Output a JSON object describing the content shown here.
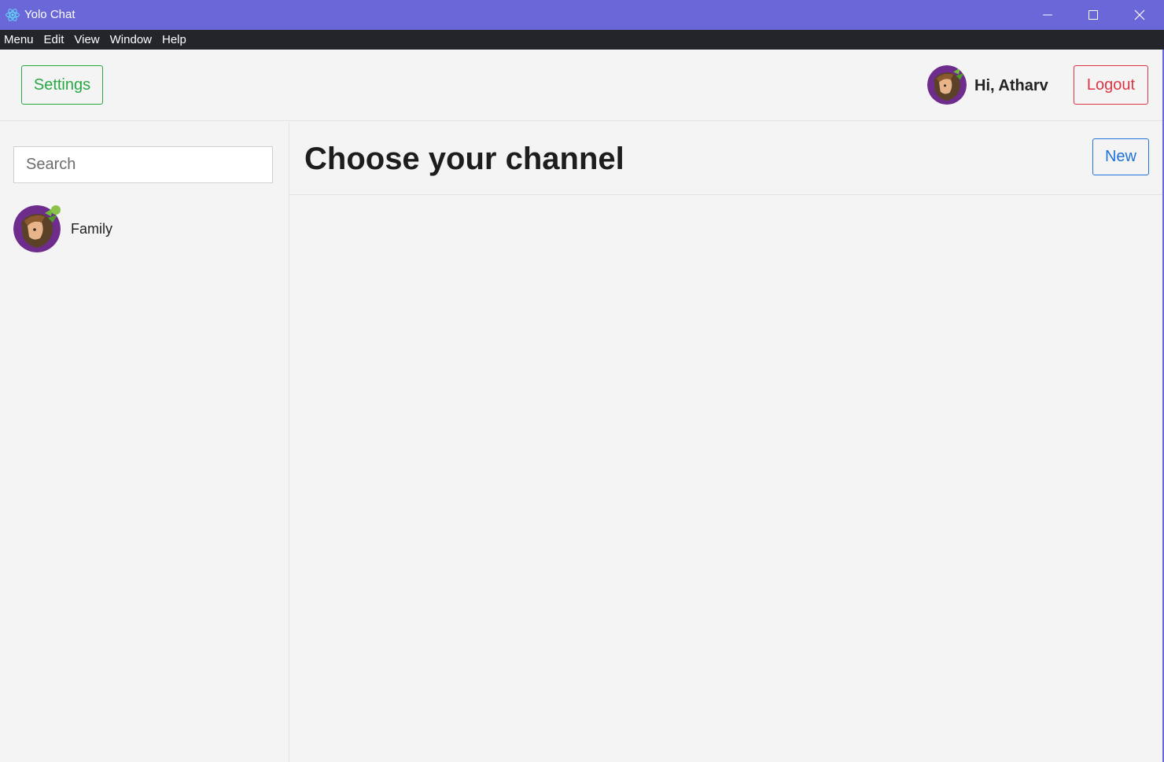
{
  "window": {
    "title": "Yolo Chat",
    "accent_color": "#6a67d8"
  },
  "menubar": {
    "items": [
      "Menu",
      "Edit",
      "View",
      "Window",
      "Help"
    ]
  },
  "header": {
    "settings_label": "Settings",
    "greeting": "Hi, Atharv",
    "logout_label": "Logout"
  },
  "sidebar": {
    "search_placeholder": "Search",
    "channels": [
      {
        "name": "Family",
        "online": true
      }
    ]
  },
  "main": {
    "title": "Choose your channel",
    "new_label": "New"
  },
  "colors": {
    "settings": "#28a745",
    "logout": "#dc3545",
    "new": "#1e73d8",
    "online": "#8bc34a",
    "menubar": "#23252b"
  }
}
